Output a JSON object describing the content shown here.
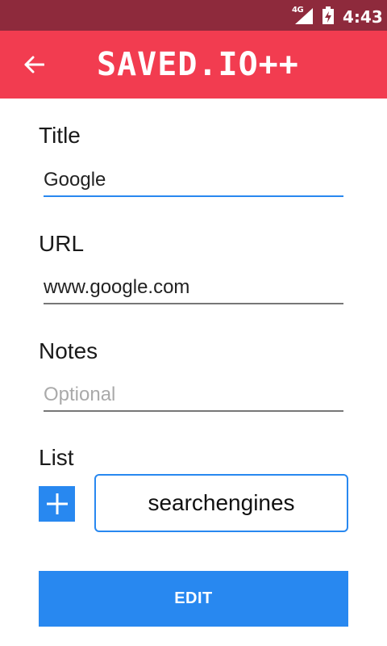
{
  "status_bar": {
    "network": "4G",
    "time": "4:43",
    "icons": [
      "signal-icon",
      "battery-charging-icon"
    ]
  },
  "app_bar": {
    "title": "SAVED.IO++",
    "back_icon": "arrow-left-icon"
  },
  "form": {
    "title": {
      "label": "Title",
      "value": "Google"
    },
    "url": {
      "label": "URL",
      "value": "www.google.com"
    },
    "notes": {
      "label": "Notes",
      "value": "",
      "placeholder": "Optional"
    },
    "list": {
      "label": "List",
      "add_icon": "plus-icon",
      "selected": "searchengines"
    },
    "submit_label": "EDIT"
  },
  "colors": {
    "status_bar": "#8e2a3c",
    "app_bar": "#f23c50",
    "accent": "#2888f0"
  }
}
